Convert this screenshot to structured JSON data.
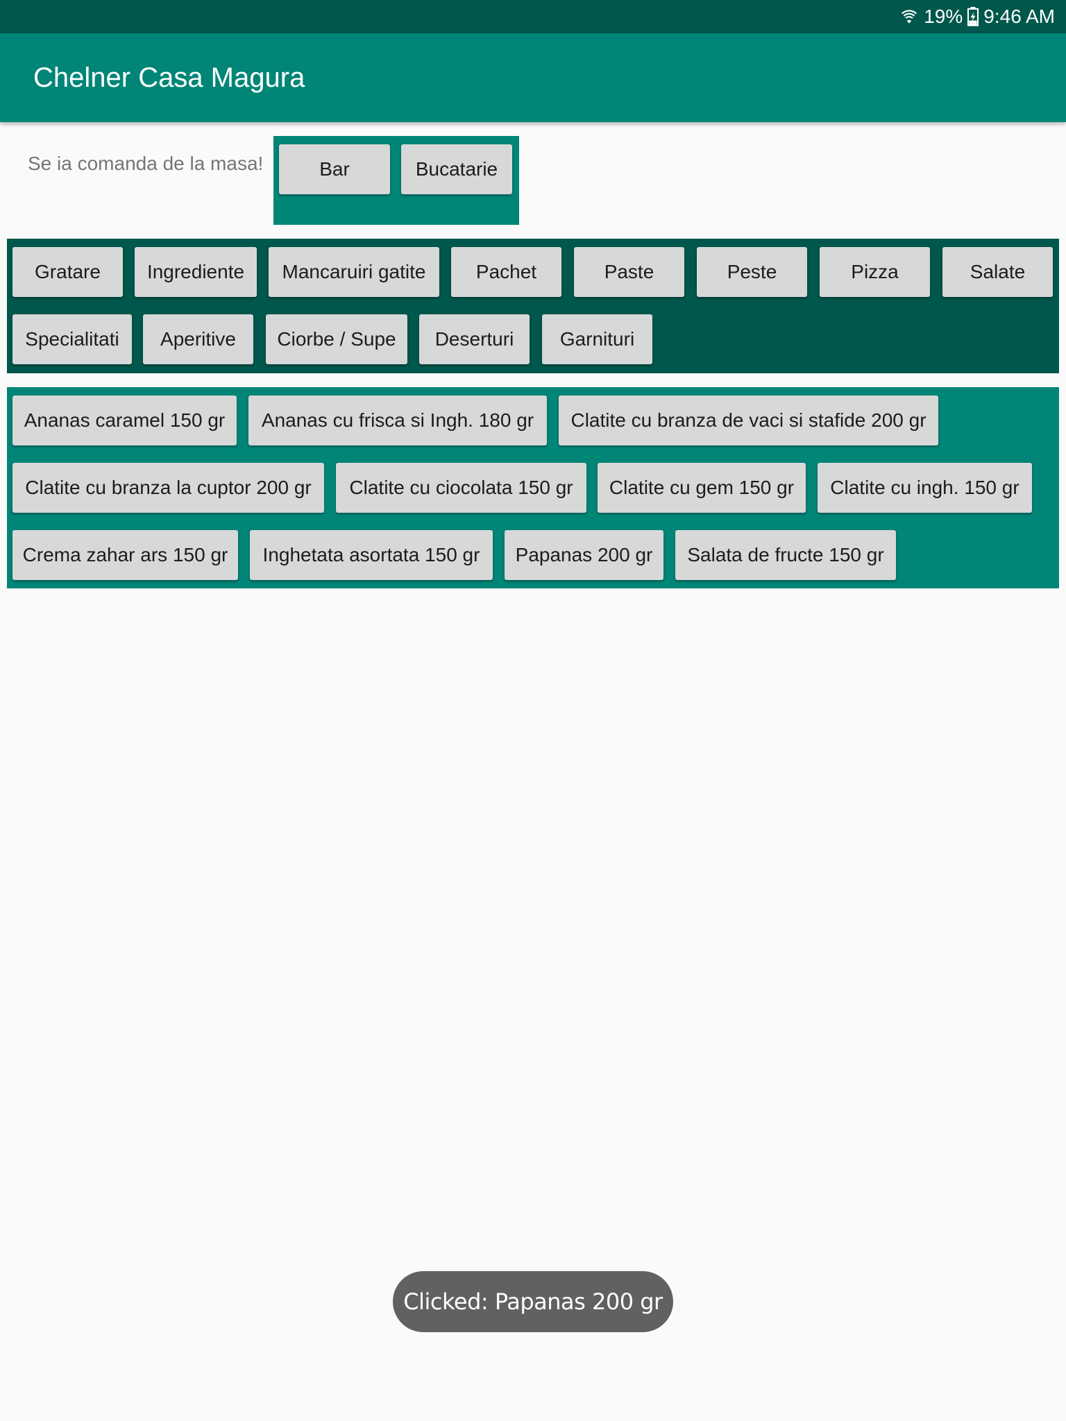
{
  "status_bar": {
    "battery": "19%",
    "time": "9:46 AM"
  },
  "app_bar": {
    "title": "Chelner Casa Magura"
  },
  "order": {
    "prompt": "Se ia comanda de la masa!",
    "destinations": [
      "Bar",
      "Bucatarie"
    ]
  },
  "categories": [
    "Gratare",
    "Ingrediente",
    "Mancaruiri gatite",
    "Pachet",
    "Paste",
    "Peste",
    "Pizza",
    "Salate",
    "Specialitati",
    "Aperitive",
    "Ciorbe / Supe",
    "Deserturi",
    "Garnituri"
  ],
  "items": [
    "Ananas caramel 150 gr",
    "Ananas cu frisca si Ingh. 180 gr",
    "Clatite cu branza de vaci si stafide 200 gr",
    "Clatite cu branza la cuptor 200 gr",
    "Clatite cu ciocolata 150 gr",
    "Clatite cu gem 150 gr",
    "Clatite cu ingh. 150 gr",
    "Crema zahar ars 150 gr",
    "Inghetata asortata 150 gr",
    "Papanas 200 gr",
    "Salata de fructe 150 gr"
  ],
  "toast": {
    "message": "Clicked: Papanas 200 gr"
  },
  "colors": {
    "primary": "#008577",
    "primary_dark": "#00574b",
    "button": "#d7d8d8"
  }
}
